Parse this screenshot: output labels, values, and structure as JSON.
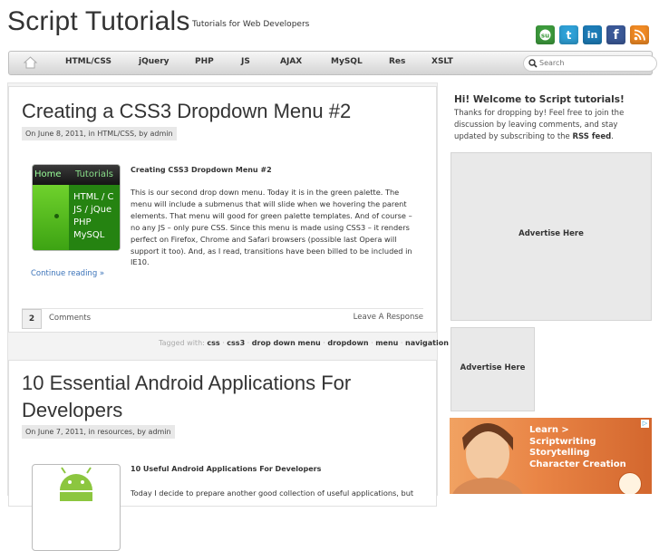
{
  "header": {
    "title": "Script Tutorials",
    "tagline": "Tutorials for Web Developers",
    "social": [
      {
        "name": "stumbleupon-icon",
        "color": "#3d9b3d",
        "glyph": "su"
      },
      {
        "name": "twitter-icon",
        "color": "#2fa0d6",
        "glyph": "t"
      },
      {
        "name": "linkedin-icon",
        "color": "#1d7cb7",
        "glyph": "in"
      },
      {
        "name": "facebook-icon",
        "color": "#3b5998",
        "glyph": "f"
      },
      {
        "name": "rss-icon",
        "color": "#f08a24",
        "glyph": "∷"
      }
    ]
  },
  "nav": {
    "items": [
      "HTML/CSS",
      "jQuery",
      "PHP",
      "JS",
      "AJAX",
      "MySQL",
      "Res",
      "XSLT"
    ],
    "search_placeholder": "Search"
  },
  "posts": [
    {
      "title": "Creating a CSS3 Dropdown Menu #2",
      "meta": "On June 8, 2011, in HTML/CSS, by admin",
      "excerpt_title": "Creating CSS3 Dropdown Menu #2",
      "excerpt": "This is our second drop down menu. Today it is in the green palette. The menu will include a submenus that will slide when we hovering the parent elements. That menu will good for green palette templates. And of course – no any JS – only pure CSS. Since this menu is made using CSS3 – it renders perfect on Firefox, Chrome and Safari browsers (possible last Opera will support it too). And, as I read, transitions have been billed to be included in IE10.",
      "continue": "Continue reading »",
      "comment_count": "2",
      "comments_label": "Comments",
      "respond": "Leave A Response",
      "thumb": {
        "top_home": "Home",
        "top_tutorials": "Tutorials",
        "menu": [
          "HTML / C",
          "JS / jQue",
          "PHP",
          "MySQL"
        ]
      }
    },
    {
      "title_line1": "10 Essential Android Applications For",
      "title_line2": "Developers",
      "meta": "On June 7, 2011, in resources, by admin",
      "excerpt_title": "10 Useful Android Applications For Developers",
      "excerpt": "Today I decide to prepare another good collection of useful applications, but"
    }
  ],
  "tags": {
    "prefix": "Tagged with:",
    "items": [
      "css",
      "css3",
      "drop down menu",
      "dropdown",
      "menu",
      "navigation"
    ]
  },
  "sidebar": {
    "welcome": "Hi! Welcome to Script tutorials!",
    "text": "Thanks for dropping by! Feel free to join the discussion by leaving comments, and stay updated by subscribing to the",
    "rss_link": "RSS feed",
    "ad1": "Advertise Here",
    "ad2": "Advertise Here",
    "promo_lines": "Learn >\nScriptwriting\nStorytelling\nCharacter Creation"
  }
}
